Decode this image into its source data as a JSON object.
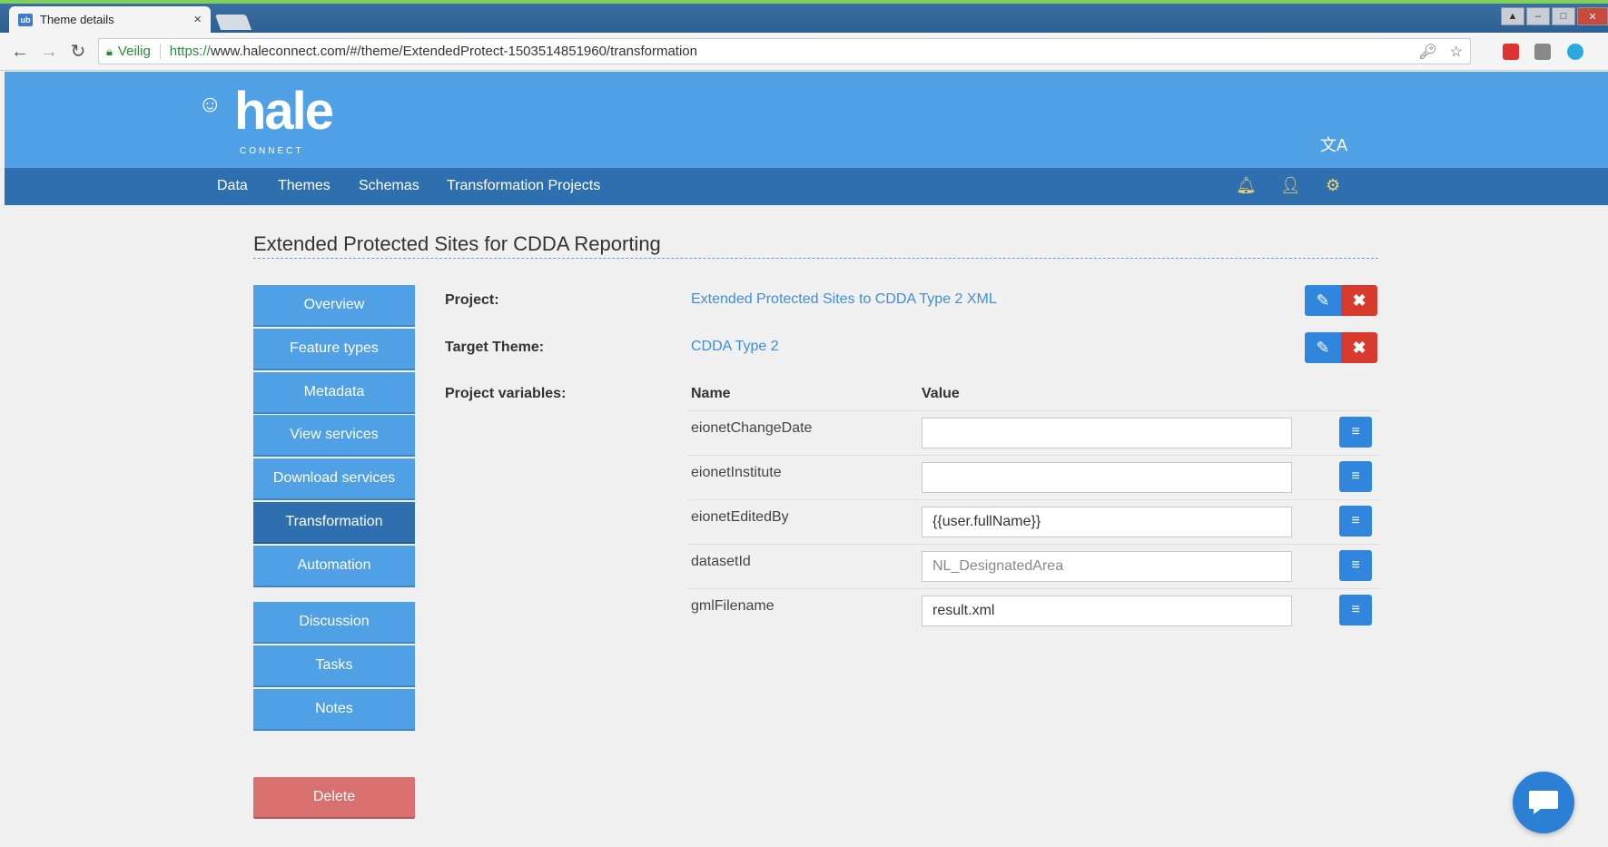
{
  "browser": {
    "tab_title": "Theme details",
    "tab_close": "×",
    "tab_favicon": "ub",
    "secure_label": "Veilig",
    "url_scheme": "https://",
    "url_rest": "www.haleconnect.com/#/theme/ExtendedProtect-1503514851960/transformation"
  },
  "header": {
    "logo_text": "hale",
    "logo_subtext": "CONNECT",
    "nav": [
      "Data",
      "Themes",
      "Schemas",
      "Transformation Projects"
    ]
  },
  "page": {
    "title": "Extended Protected Sites for CDDA Reporting"
  },
  "sidebar": {
    "items": [
      {
        "label": "Overview"
      },
      {
        "label": "Feature types"
      },
      {
        "label": "Metadata"
      },
      {
        "label": "View services"
      },
      {
        "label": "Download services"
      },
      {
        "label": "Transformation"
      },
      {
        "label": "Automation"
      },
      {
        "label": "Discussion"
      },
      {
        "label": "Tasks"
      },
      {
        "label": "Notes"
      }
    ],
    "active": "Transformation",
    "delete_label": "Delete"
  },
  "details": {
    "project_label": "Project:",
    "project_value": "Extended Protected Sites to CDDA Type 2 XML",
    "target_label": "Target Theme:",
    "target_value": "CDDA Type 2",
    "variables_label": "Project variables:",
    "col_name": "Name",
    "col_value": "Value",
    "variables": [
      {
        "name": "eionetChangeDate",
        "value": "",
        "placeholder": ""
      },
      {
        "name": "eionetInstitute",
        "value": "",
        "placeholder": ""
      },
      {
        "name": "eionetEditedBy",
        "value": "{{user.fullName}}",
        "placeholder": ""
      },
      {
        "name": "datasetId",
        "value": "",
        "placeholder": "NL_DesignatedArea"
      },
      {
        "name": "gmlFilename",
        "value": "result.xml",
        "placeholder": ""
      }
    ]
  },
  "colors": {
    "header_blue": "#4fa0e4",
    "nav_blue": "#2e6fb0",
    "link_blue": "#3f8ed8",
    "delete_red": "#d97070"
  }
}
